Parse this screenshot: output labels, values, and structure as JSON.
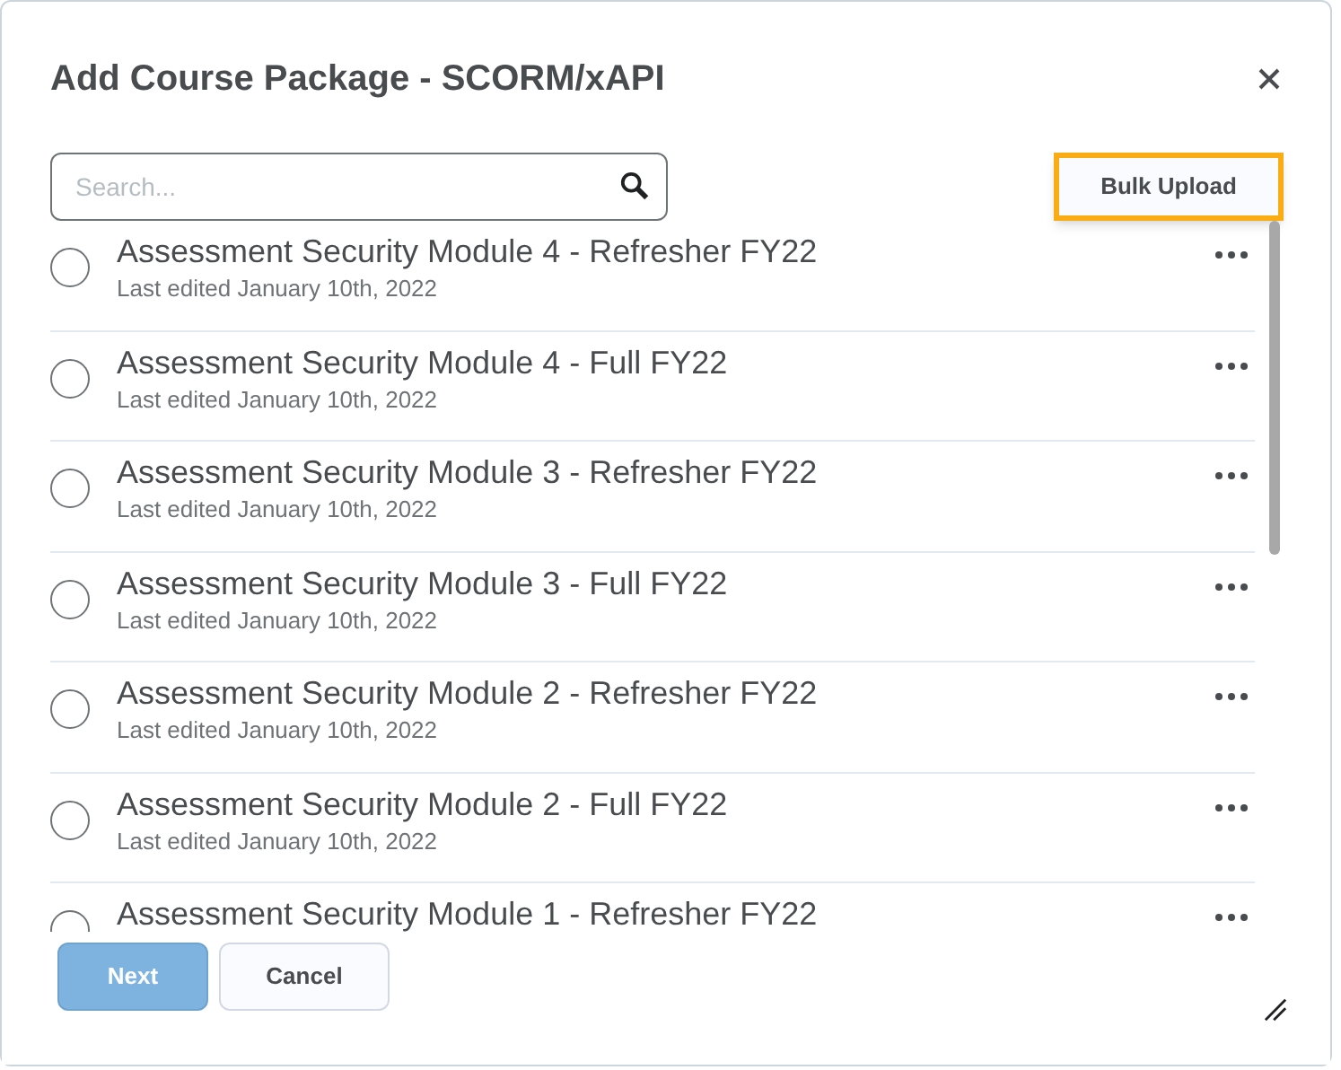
{
  "dialog": {
    "title": "Add Course Package - SCORM/xAPI"
  },
  "search": {
    "placeholder": "Search..."
  },
  "bulk_upload": {
    "label": "Bulk Upload",
    "focused": true
  },
  "packages": [
    {
      "title": "Assessment Security Module 4 - Refresher FY22",
      "subtitle": "Last edited January 10th, 2022",
      "selected": false
    },
    {
      "title": "Assessment Security Module 4 - Full FY22",
      "subtitle": "Last edited January 10th, 2022",
      "selected": false
    },
    {
      "title": "Assessment Security Module 3 - Refresher FY22",
      "subtitle": "Last edited January 10th, 2022",
      "selected": false
    },
    {
      "title": "Assessment Security Module 3 - Full FY22",
      "subtitle": "Last edited January 10th, 2022",
      "selected": false
    },
    {
      "title": "Assessment Security Module 2 - Refresher FY22",
      "subtitle": "Last edited January 10th, 2022",
      "selected": false
    },
    {
      "title": "Assessment Security Module 2 - Full FY22",
      "subtitle": "Last edited January 10th, 2022",
      "selected": false
    },
    {
      "title": "Assessment Security Module 1 - Refresher FY22",
      "selected": false
    }
  ],
  "buttons": [
    {
      "label": "Next",
      "kind": "primary",
      "disabled": true
    },
    {
      "label": "Cancel",
      "kind": "secondary",
      "disabled": false
    }
  ]
}
